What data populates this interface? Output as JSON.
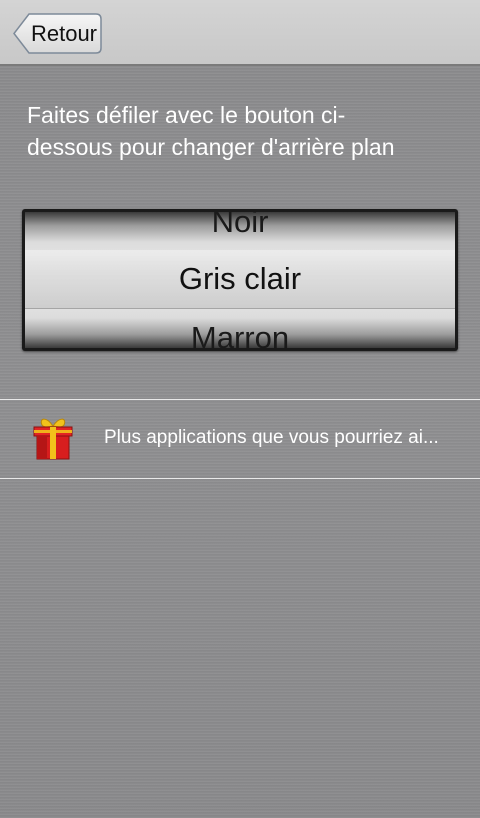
{
  "header": {
    "back_label": "Retour"
  },
  "instructions": {
    "line1": "Faites défiler avec le bouton ci-",
    "line2": "dessous pour changer d'arrière plan"
  },
  "picker": {
    "previous": "Noir",
    "selected": "Gris clair",
    "next": "Marron"
  },
  "promo": {
    "icon": "gift-icon",
    "text": "Plus applications que vous pourriez ai..."
  },
  "colors": {
    "background": "#8c8c8e",
    "top_bar": "#d0d0d0",
    "gift_red": "#d81e1e",
    "gift_ribbon": "#f2c21b"
  }
}
